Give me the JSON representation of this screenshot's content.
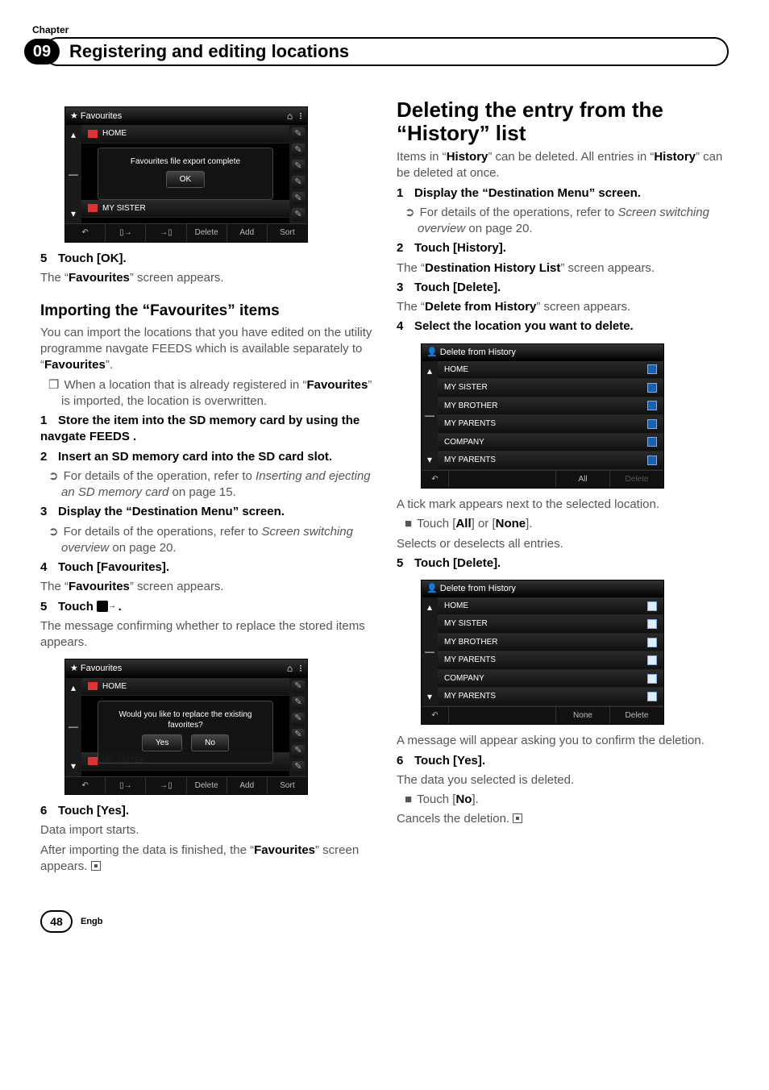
{
  "chapter": {
    "label": "Chapter",
    "number": "09",
    "title": "Registering and editing locations"
  },
  "left": {
    "fav_screenshot": {
      "title": "Favourites",
      "home": "HOME",
      "dialog_msg": "Favourites file export complete",
      "ok": "OK",
      "sister": "MY SISTER",
      "footer": {
        "delete": "Delete",
        "add": "Add",
        "sort": "Sort"
      }
    },
    "step5": {
      "num": "5",
      "label": "Touch [OK].",
      "after": "The “",
      "after_bold": "Favourites",
      "after_tail": "” screen appears."
    },
    "import_heading": "Importing the “Favourites” items",
    "import_body": "You can import the locations that you have edited on the utility programme navgate FEEDS which is available separately to “",
    "import_body_bold": "Favourites",
    "import_body_tail": "”.",
    "import_note": "When a location that is already registered in “",
    "import_note_bold": "Favourites",
    "import_note_tail": "” is imported, the location is overwritten.",
    "step1": {
      "num": "1",
      "label": "Store the item into the SD memory card by using the navgate FEEDS ."
    },
    "step2": {
      "num": "2",
      "label": "Insert an SD memory card into the SD card slot."
    },
    "step2_note_pre": "For details of the operation, refer to ",
    "step2_note_italic": "Inserting and ejecting an SD memory card",
    "step2_note_tail": " on page 15.",
    "step3": {
      "num": "3",
      "label": "Display the “Destination Menu” screen."
    },
    "step3_note_pre": "For details of the operations, refer to ",
    "step3_note_italic": "Screen switching overview",
    "step3_note_tail": " on page 20.",
    "step4": {
      "num": "4",
      "label": "Touch [Favourites].",
      "after": "The “",
      "after_bold": "Favourites",
      "after_tail": "” screen appears."
    },
    "step5b": {
      "num": "5",
      "label_pre": "Touch ",
      "label_post": "."
    },
    "step5b_after": "The message confirming whether to replace the stored items appears.",
    "replace_screenshot": {
      "title": "Favourites",
      "home": "HOME",
      "dialog_msg": "Would you like to replace the existing favorites?",
      "yes": "Yes",
      "no": "No",
      "sister": "MY SISTER",
      "footer": {
        "delete": "Delete",
        "add": "Add",
        "sort": "Sort"
      }
    },
    "step6": {
      "num": "6",
      "label": "Touch [Yes].",
      "after1": "Data import starts.",
      "after2_pre": "After importing the data is finished, the “",
      "after2_bold": "Favourites",
      "after2_tail": "” screen appears."
    }
  },
  "right": {
    "del_heading": "Deleting the entry from the “History” list",
    "del_body_pre": "Items in “",
    "del_body_bold1": "History",
    "del_body_mid": "” can be deleted. All entries in “",
    "del_body_bold2": "History",
    "del_body_tail": "” can be deleted at once.",
    "step1": {
      "num": "1",
      "label": "Display the “Destination Menu” screen."
    },
    "step1_note_pre": "For details of the operations, refer to ",
    "step1_note_italic": "Screen switching overview",
    "step1_note_tail": " on page 20.",
    "step2": {
      "num": "2",
      "label": "Touch [History].",
      "after_pre": "The “",
      "after_bold": "Destination History List",
      "after_tail": "” screen appears."
    },
    "step3": {
      "num": "3",
      "label": "Touch [Delete].",
      "after_pre": "The “",
      "after_bold": "Delete from History",
      "after_tail": "” screen appears."
    },
    "step4": {
      "num": "4",
      "label": "Select the location you want to delete."
    },
    "del_screenshot1": {
      "title": "Delete from History",
      "rows": [
        "HOME",
        "MY SISTER",
        "MY BROTHER",
        "MY PARENTS",
        "COMPANY",
        "MY PARENTS"
      ],
      "footer": {
        "all": "All",
        "delete": "Delete"
      }
    },
    "after_ss1": "A tick mark appears next to the selected location.",
    "touch_all_pre": "Touch [",
    "touch_all_bold1": "All",
    "touch_all_mid": "] or [",
    "touch_all_bold2": "None",
    "touch_all_tail": "].",
    "selects": "Selects or deselects all entries.",
    "step5": {
      "num": "5",
      "label": "Touch [Delete]."
    },
    "del_screenshot2": {
      "title": "Delete from History",
      "rows": [
        "HOME",
        "MY SISTER",
        "MY BROTHER",
        "MY PARENTS",
        "COMPANY",
        "MY PARENTS"
      ],
      "footer": {
        "none": "None",
        "delete": "Delete"
      }
    },
    "after_ss2": "A message will appear asking you to confirm the deletion.",
    "step6": {
      "num": "6",
      "label": "Touch [Yes].",
      "after": "The data you selected is deleted."
    },
    "touch_no_pre": "Touch [",
    "touch_no_bold": "No",
    "touch_no_tail": "].",
    "cancels": "Cancels the deletion."
  },
  "footer": {
    "page": "48",
    "lang": "Engb"
  }
}
